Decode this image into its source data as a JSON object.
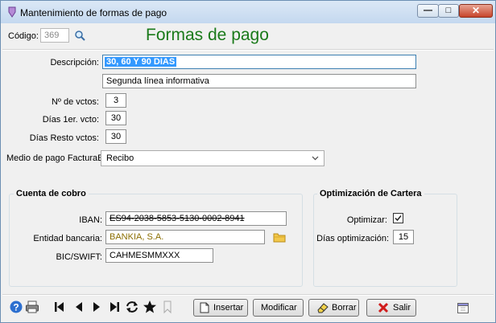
{
  "window": {
    "title": "Mantenimiento de formas de pago",
    "min_glyph": "—",
    "max_glyph": "□",
    "close_glyph": "✕"
  },
  "header": {
    "code_label": "Código:",
    "code_value": "369",
    "title": "Formas de pago"
  },
  "form": {
    "descripcion_label": "Descripción:",
    "descripcion_value": "30, 60 Y 90 DIAS",
    "linea2_value": "Segunda línea informativa",
    "num_vctos_label": "Nº de vctos:",
    "num_vctos_value": "3",
    "dias_1er_label": "Días 1er. vcto:",
    "dias_1er_value": "30",
    "dias_resto_label": "Días Resto vctos:",
    "dias_resto_value": "30",
    "medio_pago_label": "Medio de pago FacturaE:",
    "medio_pago_value": "Recibo"
  },
  "cuenta": {
    "title": "Cuenta de cobro",
    "iban_label": "IBAN:",
    "iban_value": "ES94-2038-5853-5130-0002-8941",
    "entidad_label": "Entidad bancaria:",
    "entidad_value": "BANKIA, S.A.",
    "bic_label": "BIC/SWIFT:",
    "bic_value": "CAHMESMMXXX"
  },
  "optimizacion": {
    "title": "Optimización de Cartera",
    "optimizar_label": "Optimizar:",
    "optimizar_checked": true,
    "dias_label": "Días optimización:",
    "dias_value": "15"
  },
  "toolbar": {
    "insertar": "Insertar",
    "modificar": "Modificar",
    "borrar": "Borrar",
    "salir": "Salir"
  },
  "colors": {
    "title_green": "#1a7a1a",
    "selection": "#3399ff",
    "bank_text": "#8a6d00",
    "close_red": "#c7442a"
  }
}
